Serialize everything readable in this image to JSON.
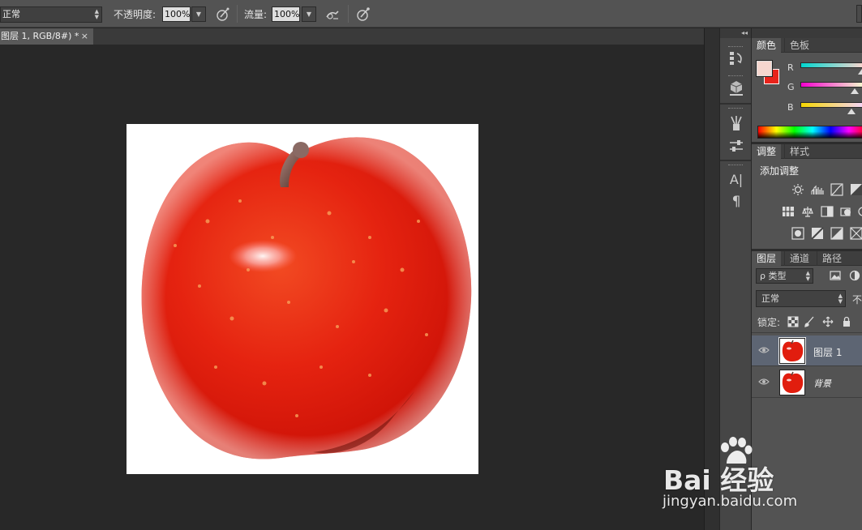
{
  "options_bar": {
    "mode_value": "正常",
    "opacity_label": "不透明度:",
    "opacity_value": "100%",
    "flow_label": "流量:",
    "flow_value": "100%",
    "icons": [
      "pressure-opacity-icon",
      "airbrush-icon",
      "pressure-size-icon"
    ]
  },
  "document": {
    "tab_title": "图层 1, RGB/8#) *",
    "close_glyph": "×"
  },
  "dock": {
    "collapse_glyph": "◂◂",
    "icons": [
      "history-icon",
      "3d-icon",
      "brush-icon",
      "brush-presets-icon",
      "character-icon",
      "paragraph-icon"
    ],
    "char_glyph": "A|",
    "para_glyph": "¶"
  },
  "color_panel": {
    "tabs": [
      "颜色",
      "色板"
    ],
    "channels": [
      {
        "label": "R",
        "gradient": "#e8231b"
      },
      {
        "label": "G",
        "gradient": "#d6cf"
      },
      {
        "label": "B",
        "gradient": "#cf"
      }
    ],
    "foreground": "#f5d6cf",
    "background": "#e8231b"
  },
  "adjust_panel": {
    "tabs": [
      "调整",
      "样式"
    ],
    "title": "添加调整"
  },
  "layers_panel": {
    "tabs": [
      "图层",
      "通道",
      "路径"
    ],
    "filter_kind": "ρ 类型",
    "blend_mode": "正常",
    "opacity_cut": "不",
    "lock_label": "锁定:",
    "layers": [
      {
        "name": "图层 1",
        "selected": true
      },
      {
        "name": "背景",
        "selected": false
      }
    ]
  },
  "watermark": {
    "brand": "Bai 经验",
    "url": "jingyan.baidu.com"
  }
}
